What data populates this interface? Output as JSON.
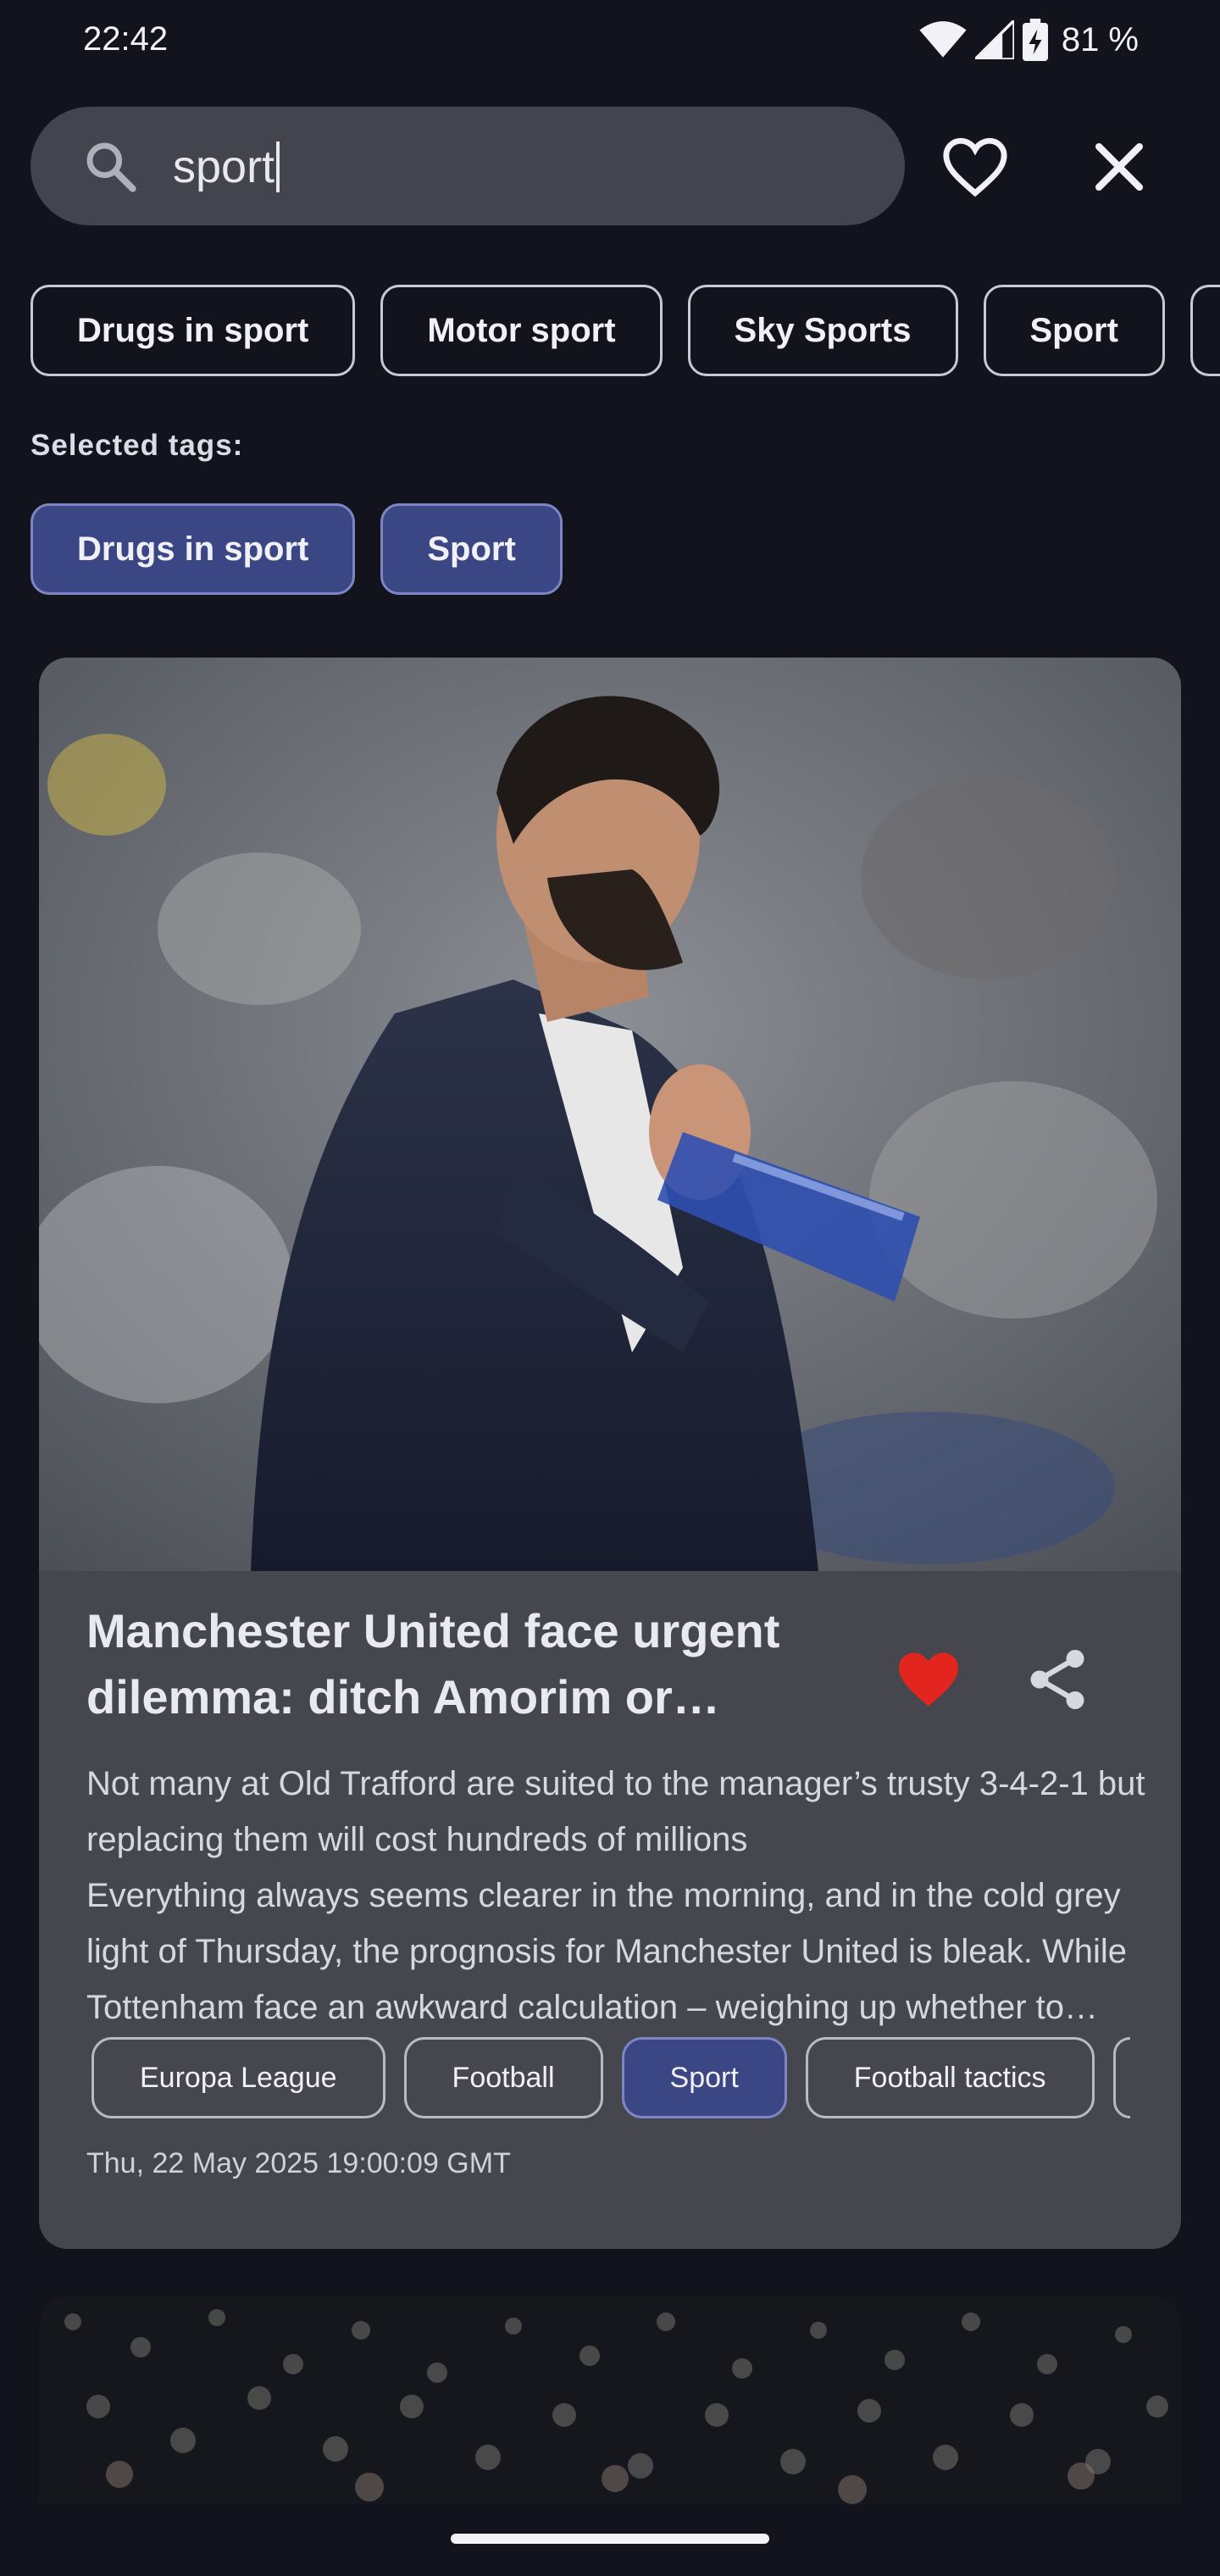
{
  "status_bar": {
    "time": "22:42",
    "battery": "81 %"
  },
  "search": {
    "query": "sport",
    "icons": [
      "search-icon",
      "heart-outline-icon",
      "close-icon"
    ]
  },
  "tag_suggestions": [
    "Drugs in sport",
    "Motor sport",
    "Sky Sports",
    "Sport"
  ],
  "selected": {
    "label": "Selected tags:",
    "tags": [
      "Drugs in sport",
      "Sport"
    ]
  },
  "article": {
    "title": "Manchester United face urgent dilemma: ditch Amorim or revamp the squad?",
    "description": "Not many at Old Trafford are suited to the manager’s trusty 3-4-2-1 but replacing them will cost hundreds of millions\nEverything always seems clearer in the morning, and in the cold grey light of Thursday, the prognosis for Manchester United is bleak. While Tottenham face an awkward calculation – weighing up whether to keep their manager",
    "tags": [
      {
        "label": "Europa League",
        "selected": false
      },
      {
        "label": "Football",
        "selected": false
      },
      {
        "label": "Sport",
        "selected": true
      },
      {
        "label": "Football tactics",
        "selected": false
      }
    ],
    "date": "Thu, 22 May 2025 19:00:09 GMT",
    "favorite": true,
    "icons": [
      "heart-filled-icon",
      "share-icon"
    ]
  },
  "colors": {
    "background": "#13131e",
    "card": "#46464f",
    "selected_chip": "#3b4684",
    "favorite": "#e2261f"
  }
}
